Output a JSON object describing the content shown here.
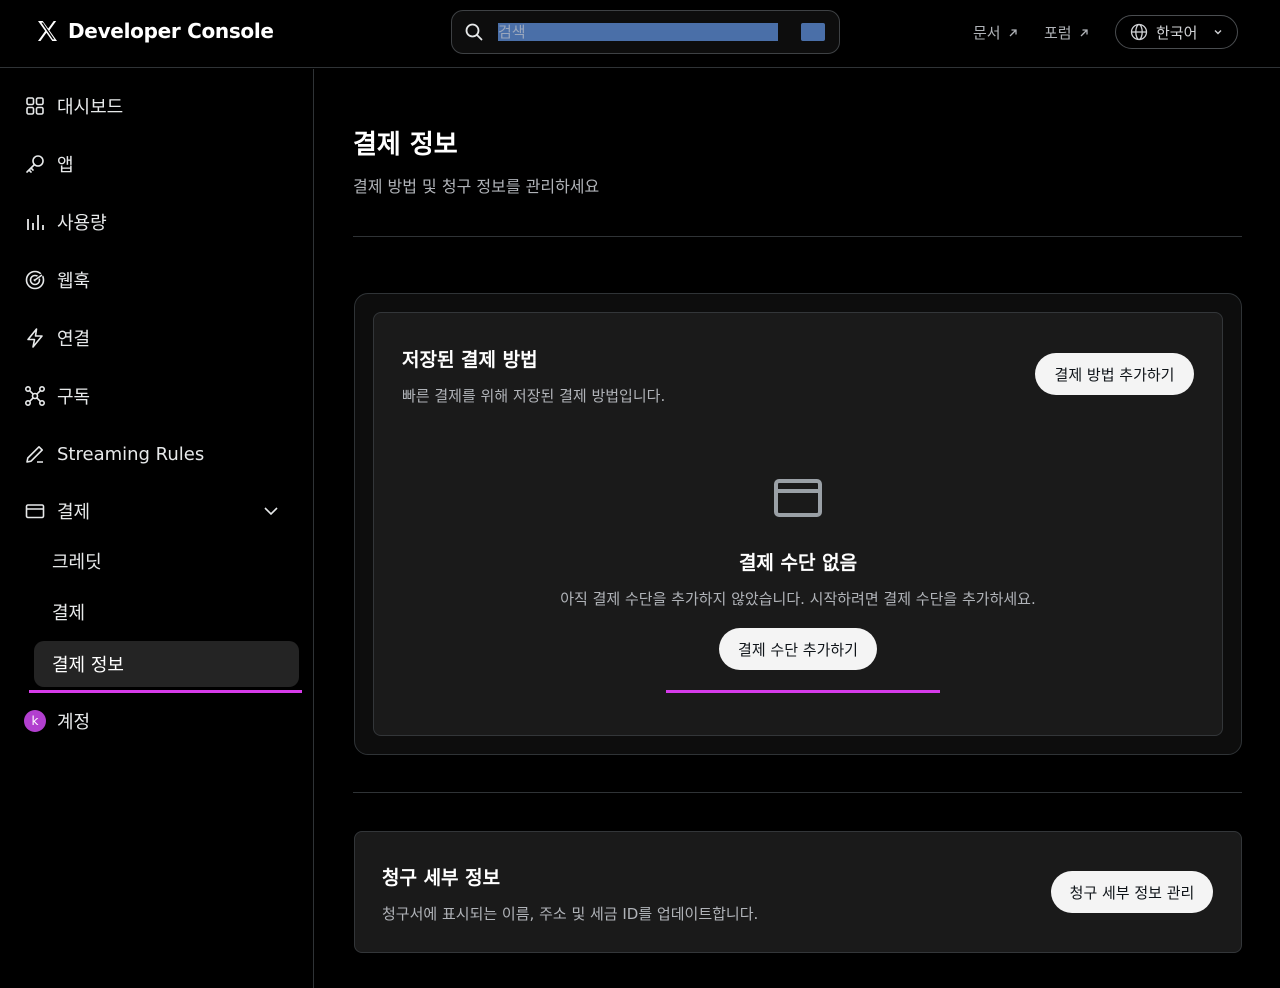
{
  "header": {
    "brand_title": "Developer Console",
    "search_placeholder": "검색",
    "links": [
      {
        "label": "문서"
      },
      {
        "label": "포럼"
      }
    ],
    "language": "한국어"
  },
  "sidebar": {
    "items": [
      {
        "label": "대시보드",
        "icon": "grid-icon"
      },
      {
        "label": "앱",
        "icon": "key-icon"
      },
      {
        "label": "사용량",
        "icon": "bar-chart-icon"
      },
      {
        "label": "웹훅",
        "icon": "webhook-icon"
      },
      {
        "label": "연결",
        "icon": "lightning-icon"
      },
      {
        "label": "구독",
        "icon": "nodes-icon"
      },
      {
        "label": "Streaming Rules",
        "icon": "pencil-icon"
      },
      {
        "label": "결제",
        "icon": "credit-card-icon"
      }
    ],
    "sub_items": [
      {
        "label": "크레딧"
      },
      {
        "label": "결제"
      },
      {
        "label": "결제 정보"
      }
    ],
    "account": {
      "label": "계정",
      "avatar_letter": "k"
    }
  },
  "main": {
    "title": "결제 정보",
    "subtitle": "결제 방법 및 청구 정보를 관리하세요",
    "saved_methods": {
      "title": "저장된 결제 방법",
      "description": "빠른 결제를 위해 저장된 결제 방법입니다.",
      "add_button": "결제 방법 추가하기",
      "empty_title": "결제 수단 없음",
      "empty_description": "아직 결제 수단을 추가하지 않았습니다. 시작하려면 결제 수단을 추가하세요.",
      "empty_button": "결제 수단 추가하기"
    },
    "billing_details": {
      "title": "청구 세부 정보",
      "description": "청구서에 표시되는 이름, 주소 및 세금 ID를 업데이트합니다.",
      "manage_button": "청구 세부 정보 관리"
    }
  },
  "colors": {
    "accent_underline": "#d63bea",
    "avatar": "#b23fcf",
    "background": "#000000",
    "card": "#1a1a1a"
  }
}
